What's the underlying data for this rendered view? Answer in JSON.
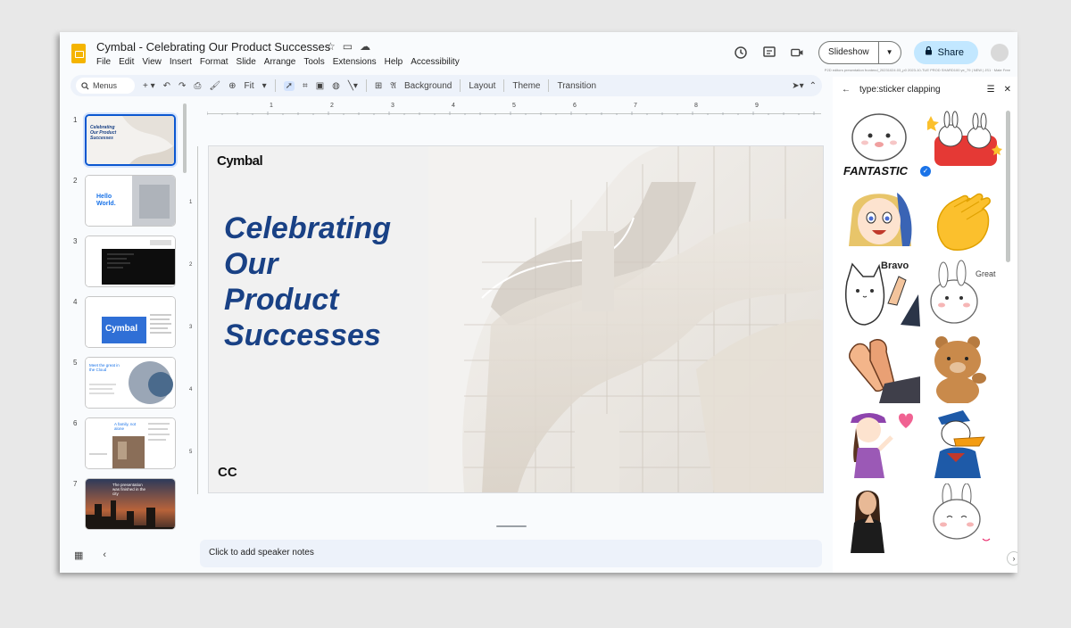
{
  "header": {
    "title": "Cymbal - Celebrating Our Product Successes",
    "menus": [
      "File",
      "Edit",
      "View",
      "Insert",
      "Format",
      "Slide",
      "Arrange",
      "Tools",
      "Extensions",
      "Help",
      "Accessibility"
    ],
    "slideshow_label": "Slideshow",
    "share_label": "Share",
    "status_text": "P2D editors presentation frontend_20231024.03_p0 2023-10-TUE PROD SHARD100 ye_79 | NEW | JS1 · Mate Free"
  },
  "toolbar": {
    "search_placeholder": "Menus",
    "zoom_label": "Fit",
    "background_label": "Background",
    "layout_label": "Layout",
    "theme_label": "Theme",
    "transition_label": "Transition"
  },
  "filmstrip": {
    "selected_index": 1,
    "slides": [
      {
        "num": "1",
        "text": "Celebrating Our Product Successes"
      },
      {
        "num": "2",
        "text": "Hello World."
      },
      {
        "num": "3",
        "text": ""
      },
      {
        "num": "4",
        "text": "Cymbal"
      },
      {
        "num": "5",
        "text": "Meet the great in the Cloud"
      },
      {
        "num": "6",
        "text": "A family, not alone"
      },
      {
        "num": "7",
        "text": "The presentation was finished in the city"
      }
    ]
  },
  "ruler": {
    "top_ticks": [
      "1",
      "2",
      "3",
      "4",
      "5",
      "6",
      "7",
      "8",
      "9"
    ],
    "left_ticks": [
      "1",
      "2",
      "3",
      "4",
      "5"
    ]
  },
  "slide": {
    "logo": "Cymbal",
    "title_lines": [
      "Celebrating",
      "Our",
      "Product",
      "Successes"
    ],
    "footer_mark": "CC",
    "title_color": "#194185"
  },
  "notes": {
    "placeholder": "Click to add speaker notes"
  },
  "sticker_panel": {
    "query": "type:sticker clapping",
    "stickers": [
      {
        "name": "fantastic-bear-sticker",
        "caption": "FANTASTIC"
      },
      {
        "name": "bunnies-cheering-sticker",
        "caption": ""
      },
      {
        "name": "anime-girl-sticker",
        "caption": ""
      },
      {
        "name": "clapping-hands-emoji-sticker",
        "caption": ""
      },
      {
        "name": "bravo-cat-sticker",
        "caption": "Bravo"
      },
      {
        "name": "bunny-great-sticker",
        "caption": "Great"
      },
      {
        "name": "cartoon-clapping-hands-sticker",
        "caption": ""
      },
      {
        "name": "brown-bear-sticker",
        "caption": ""
      },
      {
        "name": "girl-heart-sticker",
        "caption": ""
      },
      {
        "name": "donald-duck-sticker",
        "caption": ""
      },
      {
        "name": "woman-clapping-sticker",
        "caption": ""
      },
      {
        "name": "bunny-clapping-sticker",
        "caption": ""
      }
    ]
  },
  "colors": {
    "accent": "#0b57d0",
    "share_bg": "#c2e7ff",
    "toolbar_bg": "#edf2fa"
  }
}
